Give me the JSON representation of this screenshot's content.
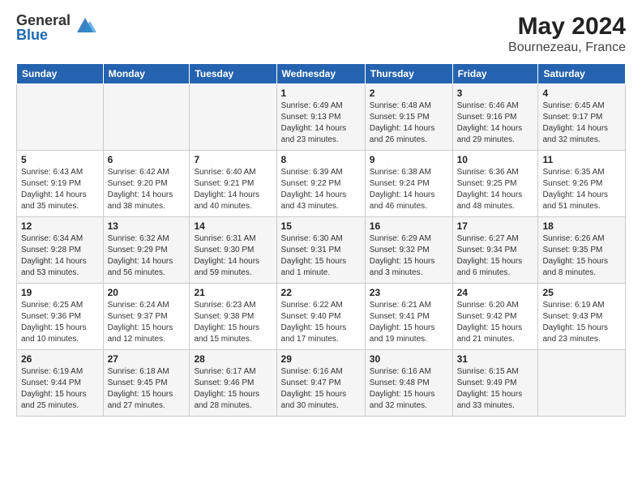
{
  "logo": {
    "general": "General",
    "blue": "Blue"
  },
  "header": {
    "month_year": "May 2024",
    "location": "Bournezeau, France"
  },
  "weekdays": [
    "Sunday",
    "Monday",
    "Tuesday",
    "Wednesday",
    "Thursday",
    "Friday",
    "Saturday"
  ],
  "weeks": [
    [
      {
        "day": "",
        "info": ""
      },
      {
        "day": "",
        "info": ""
      },
      {
        "day": "",
        "info": ""
      },
      {
        "day": "1",
        "info": "Sunrise: 6:49 AM\nSunset: 9:13 PM\nDaylight: 14 hours\nand 23 minutes."
      },
      {
        "day": "2",
        "info": "Sunrise: 6:48 AM\nSunset: 9:15 PM\nDaylight: 14 hours\nand 26 minutes."
      },
      {
        "day": "3",
        "info": "Sunrise: 6:46 AM\nSunset: 9:16 PM\nDaylight: 14 hours\nand 29 minutes."
      },
      {
        "day": "4",
        "info": "Sunrise: 6:45 AM\nSunset: 9:17 PM\nDaylight: 14 hours\nand 32 minutes."
      }
    ],
    [
      {
        "day": "5",
        "info": "Sunrise: 6:43 AM\nSunset: 9:19 PM\nDaylight: 14 hours\nand 35 minutes."
      },
      {
        "day": "6",
        "info": "Sunrise: 6:42 AM\nSunset: 9:20 PM\nDaylight: 14 hours\nand 38 minutes."
      },
      {
        "day": "7",
        "info": "Sunrise: 6:40 AM\nSunset: 9:21 PM\nDaylight: 14 hours\nand 40 minutes."
      },
      {
        "day": "8",
        "info": "Sunrise: 6:39 AM\nSunset: 9:22 PM\nDaylight: 14 hours\nand 43 minutes."
      },
      {
        "day": "9",
        "info": "Sunrise: 6:38 AM\nSunset: 9:24 PM\nDaylight: 14 hours\nand 46 minutes."
      },
      {
        "day": "10",
        "info": "Sunrise: 6:36 AM\nSunset: 9:25 PM\nDaylight: 14 hours\nand 48 minutes."
      },
      {
        "day": "11",
        "info": "Sunrise: 6:35 AM\nSunset: 9:26 PM\nDaylight: 14 hours\nand 51 minutes."
      }
    ],
    [
      {
        "day": "12",
        "info": "Sunrise: 6:34 AM\nSunset: 9:28 PM\nDaylight: 14 hours\nand 53 minutes."
      },
      {
        "day": "13",
        "info": "Sunrise: 6:32 AM\nSunset: 9:29 PM\nDaylight: 14 hours\nand 56 minutes."
      },
      {
        "day": "14",
        "info": "Sunrise: 6:31 AM\nSunset: 9:30 PM\nDaylight: 14 hours\nand 59 minutes."
      },
      {
        "day": "15",
        "info": "Sunrise: 6:30 AM\nSunset: 9:31 PM\nDaylight: 15 hours\nand 1 minute."
      },
      {
        "day": "16",
        "info": "Sunrise: 6:29 AM\nSunset: 9:32 PM\nDaylight: 15 hours\nand 3 minutes."
      },
      {
        "day": "17",
        "info": "Sunrise: 6:27 AM\nSunset: 9:34 PM\nDaylight: 15 hours\nand 6 minutes."
      },
      {
        "day": "18",
        "info": "Sunrise: 6:26 AM\nSunset: 9:35 PM\nDaylight: 15 hours\nand 8 minutes."
      }
    ],
    [
      {
        "day": "19",
        "info": "Sunrise: 6:25 AM\nSunset: 9:36 PM\nDaylight: 15 hours\nand 10 minutes."
      },
      {
        "day": "20",
        "info": "Sunrise: 6:24 AM\nSunset: 9:37 PM\nDaylight: 15 hours\nand 12 minutes."
      },
      {
        "day": "21",
        "info": "Sunrise: 6:23 AM\nSunset: 9:38 PM\nDaylight: 15 hours\nand 15 minutes."
      },
      {
        "day": "22",
        "info": "Sunrise: 6:22 AM\nSunset: 9:40 PM\nDaylight: 15 hours\nand 17 minutes."
      },
      {
        "day": "23",
        "info": "Sunrise: 6:21 AM\nSunset: 9:41 PM\nDaylight: 15 hours\nand 19 minutes."
      },
      {
        "day": "24",
        "info": "Sunrise: 6:20 AM\nSunset: 9:42 PM\nDaylight: 15 hours\nand 21 minutes."
      },
      {
        "day": "25",
        "info": "Sunrise: 6:19 AM\nSunset: 9:43 PM\nDaylight: 15 hours\nand 23 minutes."
      }
    ],
    [
      {
        "day": "26",
        "info": "Sunrise: 6:19 AM\nSunset: 9:44 PM\nDaylight: 15 hours\nand 25 minutes."
      },
      {
        "day": "27",
        "info": "Sunrise: 6:18 AM\nSunset: 9:45 PM\nDaylight: 15 hours\nand 27 minutes."
      },
      {
        "day": "28",
        "info": "Sunrise: 6:17 AM\nSunset: 9:46 PM\nDaylight: 15 hours\nand 28 minutes."
      },
      {
        "day": "29",
        "info": "Sunrise: 6:16 AM\nSunset: 9:47 PM\nDaylight: 15 hours\nand 30 minutes."
      },
      {
        "day": "30",
        "info": "Sunrise: 6:16 AM\nSunset: 9:48 PM\nDaylight: 15 hours\nand 32 minutes."
      },
      {
        "day": "31",
        "info": "Sunrise: 6:15 AM\nSunset: 9:49 PM\nDaylight: 15 hours\nand 33 minutes."
      },
      {
        "day": "",
        "info": ""
      }
    ]
  ]
}
